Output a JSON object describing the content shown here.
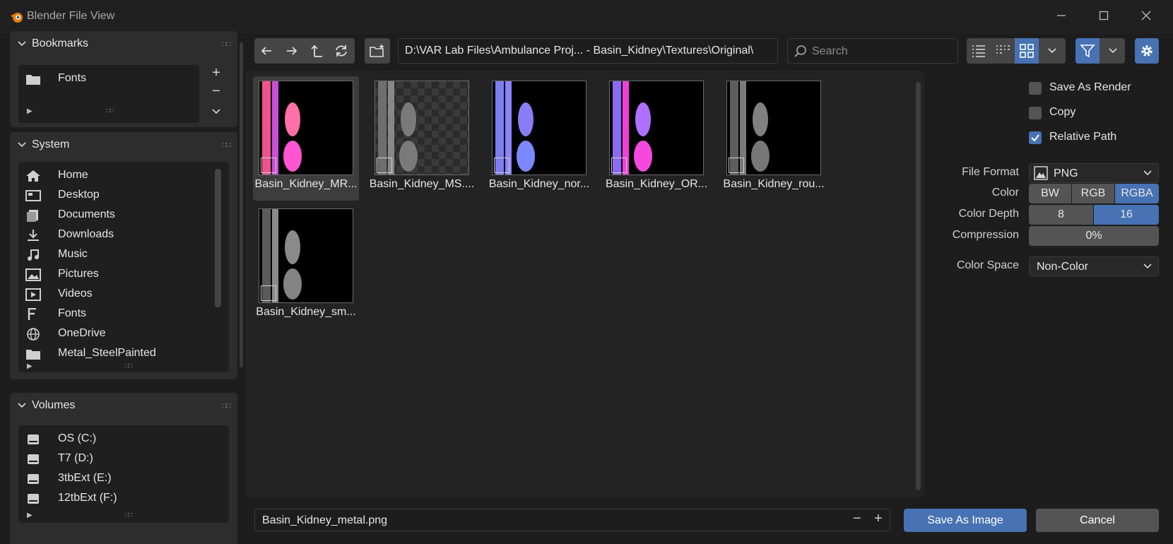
{
  "window": {
    "title": "Blender File View",
    "controls": [
      "minimize",
      "maximize",
      "close"
    ]
  },
  "sidebar": {
    "bookmarks": {
      "title": "Bookmarks",
      "items": [
        {
          "label": "Fonts",
          "icon": "folder-icon"
        }
      ],
      "add_label": "+",
      "remove_label": "−"
    },
    "system": {
      "title": "System",
      "items": [
        {
          "label": "Home",
          "icon": "home-icon"
        },
        {
          "label": "Desktop",
          "icon": "desktop-icon"
        },
        {
          "label": "Documents",
          "icon": "documents-icon"
        },
        {
          "label": "Downloads",
          "icon": "download-icon"
        },
        {
          "label": "Music",
          "icon": "music-icon"
        },
        {
          "label": "Pictures",
          "icon": "pictures-icon"
        },
        {
          "label": "Videos",
          "icon": "videos-icon"
        },
        {
          "label": "Fonts",
          "icon": "font-icon"
        },
        {
          "label": "OneDrive",
          "icon": "globe-icon"
        },
        {
          "label": "Metal_SteelPainted",
          "icon": "folder-icon"
        }
      ]
    },
    "volumes": {
      "title": "Volumes",
      "items": [
        {
          "label": "OS (C:)",
          "icon": "drive-icon"
        },
        {
          "label": "T7 (D:)",
          "icon": "drive-icon"
        },
        {
          "label": "3tbExt (E:)",
          "icon": "drive-icon"
        },
        {
          "label": "12tbExt (F:)",
          "icon": "drive-icon"
        }
      ]
    }
  },
  "toolbar": {
    "path": "D:\\VAR Lab Files\\Ambulance Proj... - Basin_Kidney\\Textures\\Original\\",
    "search_placeholder": "Search"
  },
  "files": [
    {
      "name": "Basin_Kidney_MR...",
      "selected": true
    },
    {
      "name": "Basin_Kidney_MS....",
      "selected": false
    },
    {
      "name": "Basin_Kidney_nor...",
      "selected": false
    },
    {
      "name": "Basin_Kidney_OR...",
      "selected": false
    },
    {
      "name": "Basin_Kidney_rou...",
      "selected": false
    },
    {
      "name": "Basin_Kidney_sm...",
      "selected": false
    }
  ],
  "options": {
    "save_as_render": {
      "label": "Save As Render",
      "checked": false
    },
    "copy": {
      "label": "Copy",
      "checked": false
    },
    "relative_path": {
      "label": "Relative Path",
      "checked": true
    },
    "file_format": {
      "label": "File Format",
      "value": "PNG"
    },
    "color": {
      "label": "Color",
      "choices": [
        "BW",
        "RGB",
        "RGBA"
      ],
      "selected": "RGBA"
    },
    "color_depth": {
      "label": "Color Depth",
      "choices": [
        "8",
        "16"
      ],
      "selected": "16"
    },
    "compression": {
      "label": "Compression",
      "value": "0%"
    },
    "color_space": {
      "label": "Color Space",
      "value": "Non-Color"
    }
  },
  "footer": {
    "filename": "Basin_Kidney_metal.png",
    "minus_label": "−",
    "plus_label": "+",
    "save_label": "Save As Image",
    "cancel_label": "Cancel"
  },
  "colors": {
    "accent": "#4772b3",
    "background": "#1d1d1d",
    "panel": "#2d2d2d"
  }
}
